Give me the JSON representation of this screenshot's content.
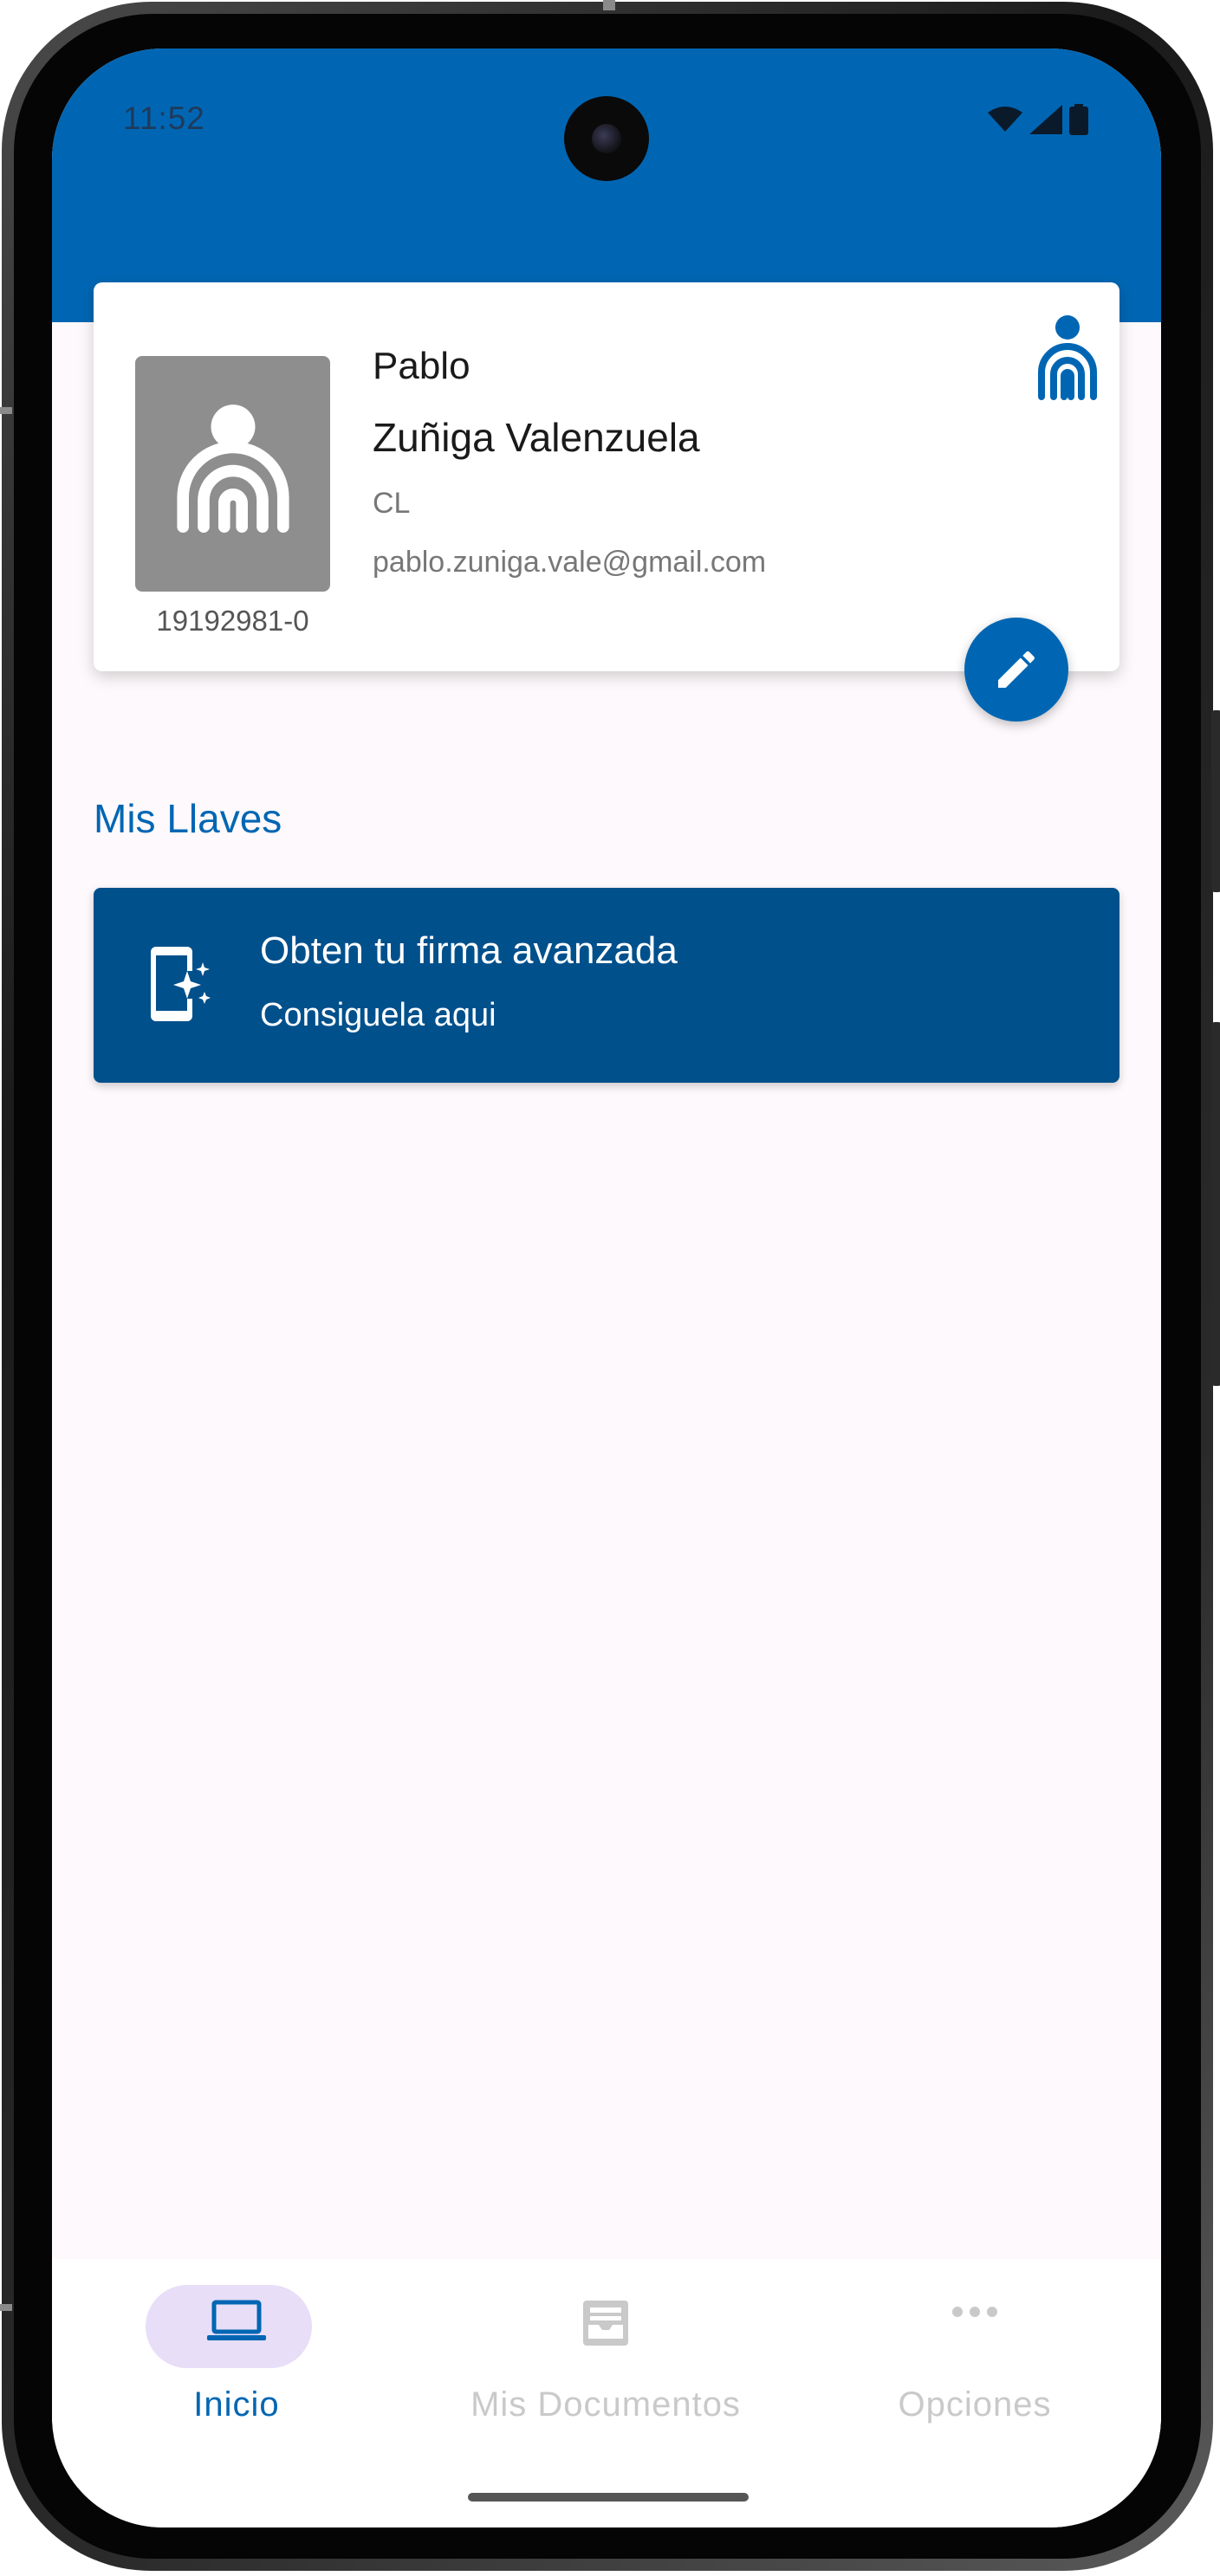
{
  "status_bar": {
    "time": "11:52"
  },
  "profile": {
    "first_name": "Pablo",
    "last_name": "Zuñiga Valenzuela",
    "country": "CL",
    "email": "pablo.zuniga.vale@gmail.com",
    "rut": "19192981-0",
    "avatar_icon": "fingerprint-person-icon",
    "identity_icon": "fingerprint-person-icon",
    "edit_icon": "pencil-icon"
  },
  "keys_section": {
    "title": "Mis Llaves",
    "sign_card": {
      "title": "Obten tu firma avanzada",
      "subtitle": "Consiguela aqui",
      "icon": "phone-sparkle-icon"
    }
  },
  "bottom_nav": {
    "items": [
      {
        "label": "Inicio",
        "icon": "laptop-icon",
        "active": true
      },
      {
        "label": "Mis Documentos",
        "icon": "inbox-tray-icon",
        "active": false
      },
      {
        "label": "Opciones",
        "icon": "more-horizontal-icon",
        "active": false
      }
    ]
  },
  "colors": {
    "primary": "#0066b3",
    "sign_card_bg": "#00508c",
    "nav_active_pill": "#e8def8",
    "background": "#fdf9fc"
  }
}
